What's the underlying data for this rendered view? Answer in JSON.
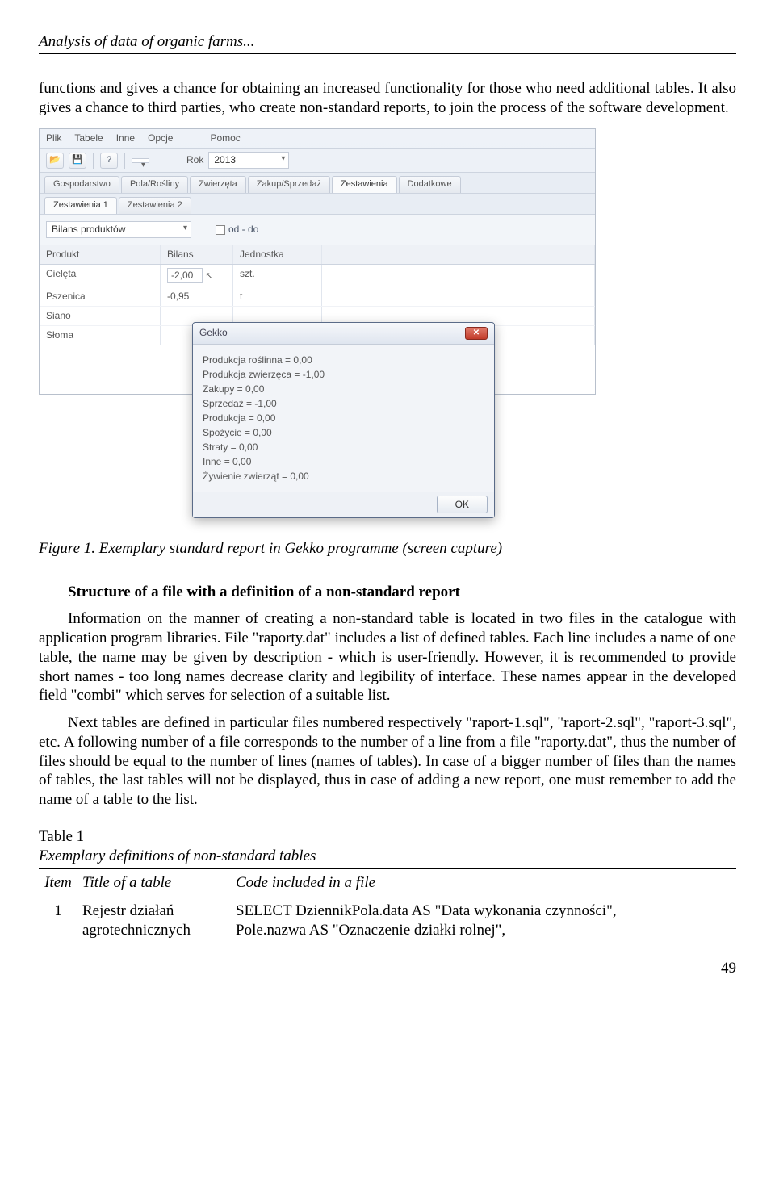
{
  "header": "Analysis of data of organic farms...",
  "para1": "functions and gives a chance for obtaining an increased functionality for those who need additional tables. It also gives a chance to third parties, who create non-standard reports, to join the process of the software development.",
  "app": {
    "menu": {
      "plik": "Plik",
      "tabele": "Tabele",
      "inne": "Inne",
      "opcje": "Opcje",
      "pomoc": "Pomoc"
    },
    "toolbar": {
      "rok_label": "Rok",
      "rok_value": "2013"
    },
    "tabs1": {
      "gospodarstwo": "Gospodarstwo",
      "pola": "Pola/Rośliny",
      "zwierzeta": "Zwierzęta",
      "zakup": "Zakup/Sprzedaż",
      "zestawienia": "Zestawienia",
      "dodatkowe": "Dodatkowe"
    },
    "tabs2": {
      "z1": "Zestawienia 1",
      "z2": "Zestawienia 2"
    },
    "filter": {
      "combo": "Bilans produktów",
      "oddo": "od - do"
    },
    "grid": {
      "h_produkt": "Produkt",
      "h_bilans": "Bilans",
      "h_jednostka": "Jednostka",
      "r1_produkt": "Cielęta",
      "r1_bilans": "-2,00",
      "r1_jed": "szt.",
      "r2_produkt": "Pszenica",
      "r2_bilans": "-0,95",
      "r2_jed": "t",
      "r3_produkt": "Siano",
      "r4_produkt": "Słoma"
    },
    "dialog": {
      "title": "Gekko",
      "l1": "Produkcja roślinna = 0,00",
      "l2": "Produkcja zwierzęca = -1,00",
      "l3": "Zakupy = 0,00",
      "l4": "Sprzedaż = -1,00",
      "l5": "Produkcja = 0,00",
      "l6": "Spożycie = 0,00",
      "l7": "Straty = 0,00",
      "l8": "Inne = 0,00",
      "l9": "Żywienie zwierząt = 0,00",
      "ok": "OK"
    }
  },
  "fig_caption": "Figure 1. Exemplary standard report in Gekko programme (screen capture)",
  "section_title": "Structure of a file with a definition of a non-standard report",
  "para2": "Information on the manner of creating a non-standard table is located in two files in the catalogue with application program libraries. File \"raporty.dat\" includes a list of defined tables. Each line includes a name of one table, the name may be given by description - which is user-friendly. However, it is recommended to provide short names - too long names decrease clarity and legibility of interface. These names appear in the developed field \"combi\" which serves for selection of a suitable list.",
  "para3": "Next tables are defined in particular files numbered respectively \"raport-1.sql\", \"raport-2.sql\", \"raport-3.sql\", etc. A following number of a file corresponds to the number of a line from a file \"raporty.dat\", thus the number of files should be equal to the number of lines (names of tables). In case of a bigger number of files than the names of tables, the last tables will not be displayed, thus in case of adding a new report, one must remember to add the name of a table to the list.",
  "table": {
    "label": "Table 1",
    "caption": "Exemplary definitions of non-standard tables",
    "h_item": "Item",
    "h_title": "Title of a table",
    "h_code": "Code included in a file",
    "r1_item": "1",
    "r1_title": "Rejestr działań agrotechnicznych",
    "r1_code_l1": "SELECT DziennikPola.data AS \"Data wykonania czynności\",",
    "r1_code_l2": "Pole.nazwa AS \"Oznaczenie działki rolnej\","
  },
  "page_num": "49"
}
